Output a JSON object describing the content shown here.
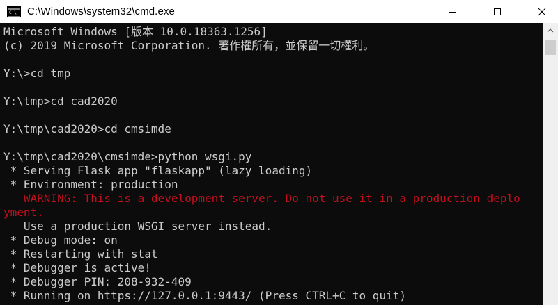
{
  "window": {
    "title": "C:\\Windows\\system32\\cmd.exe",
    "icon": "cmd-console-icon",
    "buttons": {
      "minimize_icon": "minimize-icon",
      "maximize_icon": "maximize-icon",
      "close_icon": "close-icon"
    }
  },
  "colors": {
    "background": "#0c0c0c",
    "text": "#cccccc",
    "warning": "#c50f1f",
    "titlebar": "#ffffff"
  },
  "console": {
    "lines": [
      "Microsoft Windows [版本 10.0.18363.1256]",
      "(c) 2019 Microsoft Corporation. 著作權所有，並保留一切權利。",
      "",
      "Y:\\>cd tmp",
      "",
      "Y:\\tmp>cd cad2020",
      "",
      "Y:\\tmp\\cad2020>cd cmsimde",
      "",
      "Y:\\tmp\\cad2020\\cmsimde>python wsgi.py",
      " * Serving Flask app \"flaskapp\" (lazy loading)",
      " * Environment: production",
      "   WARNING: This is a development server. Do not use it in a production deplo",
      "yment.",
      "   Use a production WSGI server instead.",
      " * Debug mode: on",
      " * Restarting with stat",
      " * Debugger is active!",
      " * Debugger PIN: 208-932-409",
      " * Running on https://127.0.0.1:9443/ (Press CTRL+C to quit)"
    ]
  }
}
